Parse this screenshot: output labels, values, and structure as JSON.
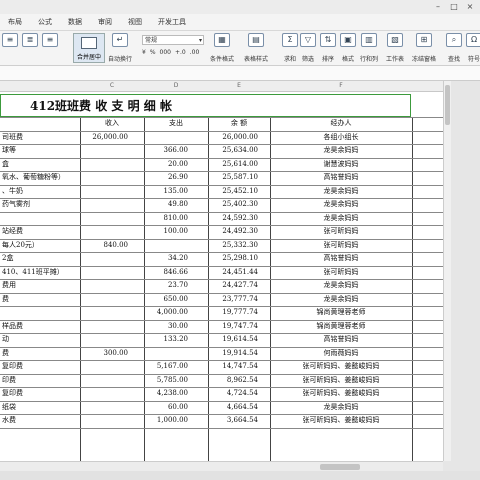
{
  "menu": [
    "布局",
    "公式",
    "数据",
    "审阅",
    "视图",
    "开发工具"
  ],
  "ribbon": {
    "merge_label": "合并居中",
    "wrap_label": "自动换行",
    "number_format": "常规",
    "number_symbols": [
      "¥",
      "%",
      "000",
      "+.0",
      ".00"
    ],
    "tools": [
      {
        "label": "条件格式",
        "icon": "conditional-format-icon"
      },
      {
        "label": "表格样式",
        "icon": "table-style-icon"
      },
      {
        "label": "求和",
        "icon": "sum-icon"
      },
      {
        "label": "筛选",
        "icon": "filter-icon"
      },
      {
        "label": "排序",
        "icon": "sort-icon"
      },
      {
        "label": "格式",
        "icon": "format-icon"
      },
      {
        "label": "行和列",
        "icon": "row-col-icon"
      },
      {
        "label": "工作表",
        "icon": "worksheet-icon"
      },
      {
        "label": "冻结窗格",
        "icon": "freeze-icon"
      },
      {
        "label": "查找",
        "icon": "find-icon"
      },
      {
        "label": "符号",
        "icon": "symbol-icon"
      }
    ]
  },
  "columns": [
    "C",
    "D",
    "E",
    "F"
  ],
  "sheet": {
    "title": "412班班费  收 支 明 细 帐",
    "headers": {
      "income": "收入",
      "expense": "支出",
      "balance": "余  额",
      "handler": "经办人"
    },
    "rows": [
      {
        "desc": "司班费",
        "income": "26,000.00",
        "expense": "",
        "balance": "26,000.00",
        "handler": "各组小组长"
      },
      {
        "desc": "球等",
        "income": "",
        "expense": "366.00",
        "balance": "25,634.00",
        "handler": "龙昊余妈妈"
      },
      {
        "desc": "盒",
        "income": "",
        "expense": "20.00",
        "balance": "25,614.00",
        "handler": "谢慧波妈妈"
      },
      {
        "desc": "氧水、葡萄糖粉等）",
        "income": "",
        "expense": "26.90",
        "balance": "25,587.10",
        "handler": "高铭誉妈妈"
      },
      {
        "desc": "、牛奶",
        "income": "",
        "expense": "135.00",
        "balance": "25,452.10",
        "handler": "龙昊余妈妈"
      },
      {
        "desc": "药气雾剂",
        "income": "",
        "expense": "49.80",
        "balance": "25,402.30",
        "handler": "龙昊余妈妈"
      },
      {
        "desc": "",
        "income": "",
        "expense": "810.00",
        "balance": "24,592.30",
        "handler": "龙昊余妈妈"
      },
      {
        "desc": "站经费",
        "income": "",
        "expense": "100.00",
        "balance": "24,492.30",
        "handler": "张可昕妈妈"
      },
      {
        "desc": "每人20元）",
        "income": "840.00",
        "expense": "",
        "balance": "25,332.30",
        "handler": "张可昕妈妈"
      },
      {
        "desc": "2盒",
        "income": "",
        "expense": "34.20",
        "balance": "25,298.10",
        "handler": "高铭誉妈妈"
      },
      {
        "desc": "410、411班平摊）",
        "income": "",
        "expense": "846.66",
        "balance": "24,451.44",
        "handler": "张可昕妈妈"
      },
      {
        "desc": "费用",
        "income": "",
        "expense": "23.70",
        "balance": "24,427.74",
        "handler": "龙昊余妈妈"
      },
      {
        "desc": "费",
        "income": "",
        "expense": "650.00",
        "balance": "23,777.74",
        "handler": "龙昊余妈妈"
      },
      {
        "desc": "",
        "income": "",
        "expense": "4,000.00",
        "balance": "19,777.74",
        "handler": "锦尚黄理蓉老师"
      },
      {
        "desc": "样品费",
        "income": "",
        "expense": "30.00",
        "balance": "19,747.74",
        "handler": "锦尚黄理蓉老师"
      },
      {
        "desc": "动",
        "income": "",
        "expense": "133.20",
        "balance": "19,614.54",
        "handler": "高铭誉妈妈"
      },
      {
        "desc": "费",
        "income": "300.00",
        "expense": "",
        "balance": "19,914.54",
        "handler": "何雨薇妈妈"
      },
      {
        "desc": "复印费",
        "income": "",
        "expense": "5,167.00",
        "balance": "14,747.54",
        "handler": "张可昕妈妈、姜懿峻妈妈"
      },
      {
        "desc": "印费",
        "income": "",
        "expense": "5,785.00",
        "balance": "8,962.54",
        "handler": "张可昕妈妈、姜懿峻妈妈"
      },
      {
        "desc": "复印费",
        "income": "",
        "expense": "4,238.00",
        "balance": "4,724.54",
        "handler": "张可昕妈妈、姜懿峻妈妈"
      },
      {
        "desc": "纸袋",
        "income": "",
        "expense": "60.00",
        "balance": "4,664.54",
        "handler": "龙昊余妈妈"
      },
      {
        "desc": "水费",
        "income": "",
        "expense": "1,000.00",
        "balance": "3,664.54",
        "handler": "张可昕妈妈、姜懿峻妈妈"
      }
    ]
  }
}
